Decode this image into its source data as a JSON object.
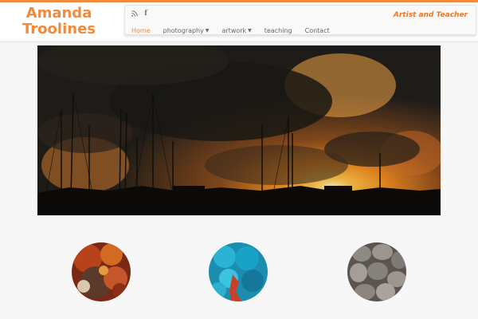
{
  "site": {
    "logo_line1": "Amanda",
    "logo_line2": "Troolines",
    "tagline": "Artist and Teacher",
    "accent_color": "#f08a3c"
  },
  "social": [
    {
      "icon": "rss-icon"
    },
    {
      "icon": "facebook-icon"
    }
  ],
  "nav": [
    {
      "label": "Home",
      "active": true
    },
    {
      "label": "photography",
      "dropdown": true
    },
    {
      "label": "artwork",
      "dropdown": true
    },
    {
      "label": "teaching"
    },
    {
      "label": "Contact"
    }
  ],
  "hero": {
    "description_icon": "sunset-harbor-photo"
  },
  "thumbnails": [
    {
      "icon": "rust-texture-photo"
    },
    {
      "icon": "turquoise-stones-photo"
    },
    {
      "icon": "pebbles-photo"
    }
  ]
}
